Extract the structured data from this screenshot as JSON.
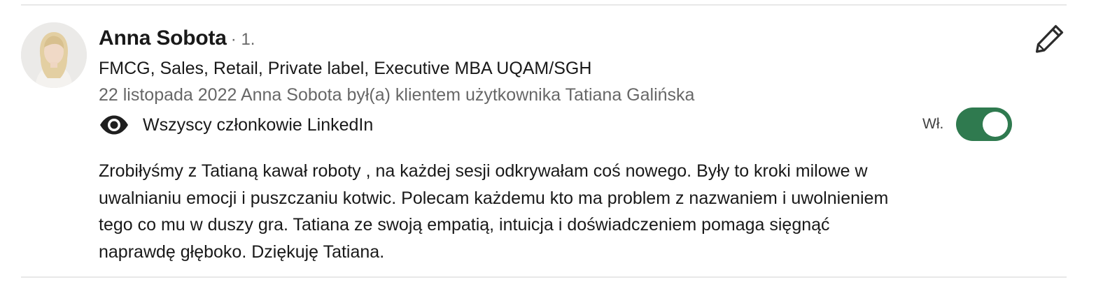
{
  "recommendation": {
    "author_name": "Anna Sobota",
    "connection_degree": "· 1.",
    "headline": "FMCG, Sales, Retail, Private label, Executive MBA UQAM/SGH",
    "meta": "22 listopada 2022 Anna Sobota był(a) klientem użytkownika Tatiana Galińska",
    "visibility_icon": "eye-icon",
    "visibility_label": "Wszyscy członkowie LinkedIn",
    "toggle_label": "Wł.",
    "toggle_on": true,
    "body_lines": [
      "Zrobiłyśmy z Tatianą kawał roboty , na każdej sesji odkrywałam coś nowego. Były to kroki milowe w",
      "uwalnianiu emocji i puszczaniu kotwic. Polecam każdemu kto ma problem z nazwaniem i uwolnieniem",
      "tego co mu w duszy gra. Tatiana ze swoją empatią, intuicja i doświadczeniem pomaga sięgnąć",
      "naprawdę głęboko. Dziękuję Tatiana."
    ],
    "edit_icon": "pencil-icon"
  },
  "colors": {
    "toggle_on": "#2f7a4f",
    "divider": "#e8e8e8",
    "secondary_text": "#666666"
  }
}
